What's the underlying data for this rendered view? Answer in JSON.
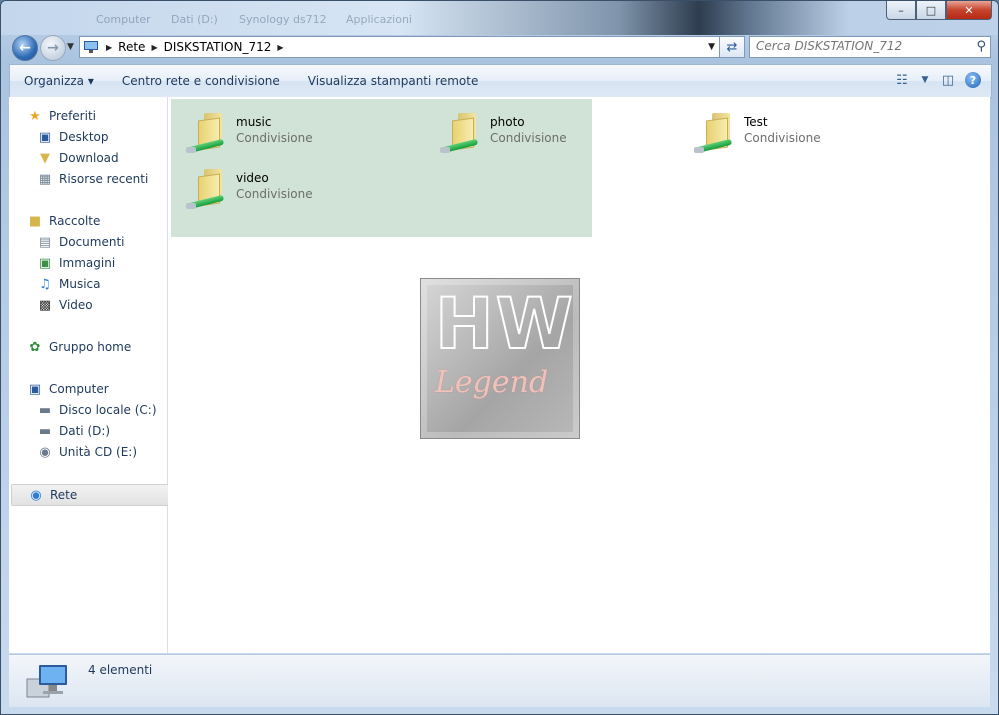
{
  "titlebar": {
    "ghost_path": [
      "Computer",
      "Dati (D:)",
      "Synology ds712",
      "Applicazioni"
    ],
    "buttons": {
      "minimize": "–",
      "maximize": "□",
      "close": "✕"
    }
  },
  "address": {
    "segments": [
      "Rete",
      "DISKSTATION_712"
    ],
    "search_placeholder": "Cerca DISKSTATION_712"
  },
  "toolbar": {
    "organize": "Organizza",
    "organize_caret": "▾",
    "network_center": "Centro rete e condivisione",
    "remote_printers": "Visualizza stampanti remote",
    "help": "?"
  },
  "sidebar": {
    "favorites": {
      "label": "Preferiti",
      "items": [
        "Desktop",
        "Download",
        "Risorse recenti"
      ]
    },
    "libraries": {
      "label": "Raccolte",
      "items": [
        "Documenti",
        "Immagini",
        "Musica",
        "Video"
      ]
    },
    "homegroup": {
      "label": "Gruppo home"
    },
    "computer": {
      "label": "Computer",
      "items": [
        "Disco locale (C:)",
        "Dati (D:)",
        "Unità CD (E:)"
      ]
    },
    "network": {
      "label": "Rete"
    }
  },
  "items": [
    {
      "name": "music",
      "type": "Condivisione"
    },
    {
      "name": "photo",
      "type": "Condivisione"
    },
    {
      "name": "Test",
      "type": "Condivisione"
    },
    {
      "name": "video",
      "type": "Condivisione"
    }
  ],
  "watermark": {
    "line1": "HW",
    "line2": "Legend"
  },
  "status": {
    "count": "4 elementi"
  },
  "colors": {
    "selection": "#d0e3d6",
    "link_text": "#1e395b",
    "secondary_text": "#6d6d6d"
  }
}
